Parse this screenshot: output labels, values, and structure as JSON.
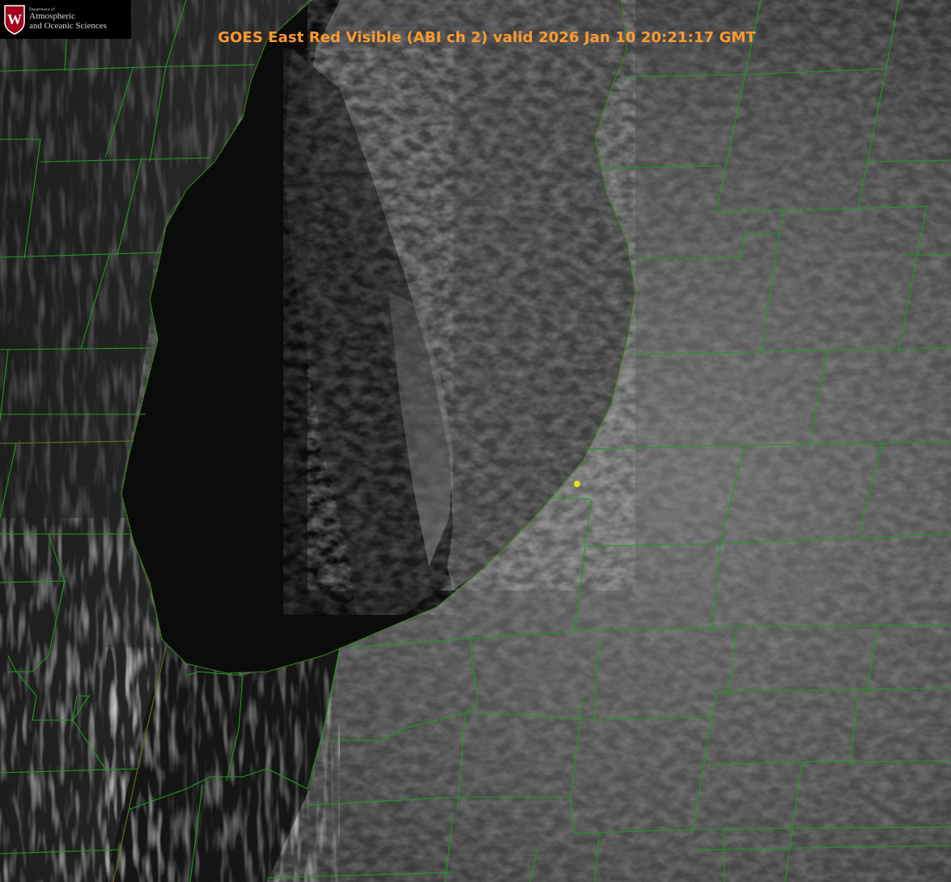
{
  "title": "GOES East Red Visible (ABI ch 2) valid 2026 Jan 10 20:21:17 GMT",
  "logo": {
    "crest_letter": "W",
    "department": "Department of",
    "line1": "Atmospheric",
    "line2": "and Oceanic Sciences"
  },
  "colors": {
    "county_lines": "#1f9a1f",
    "lake_shoreline": "#cc2a2a",
    "title": "#ff9a2e",
    "site_marker": "#e8e020",
    "crest": "#a3001f"
  },
  "icons": {
    "crest": "university-crest-icon",
    "marker": "station-marker-icon"
  }
}
